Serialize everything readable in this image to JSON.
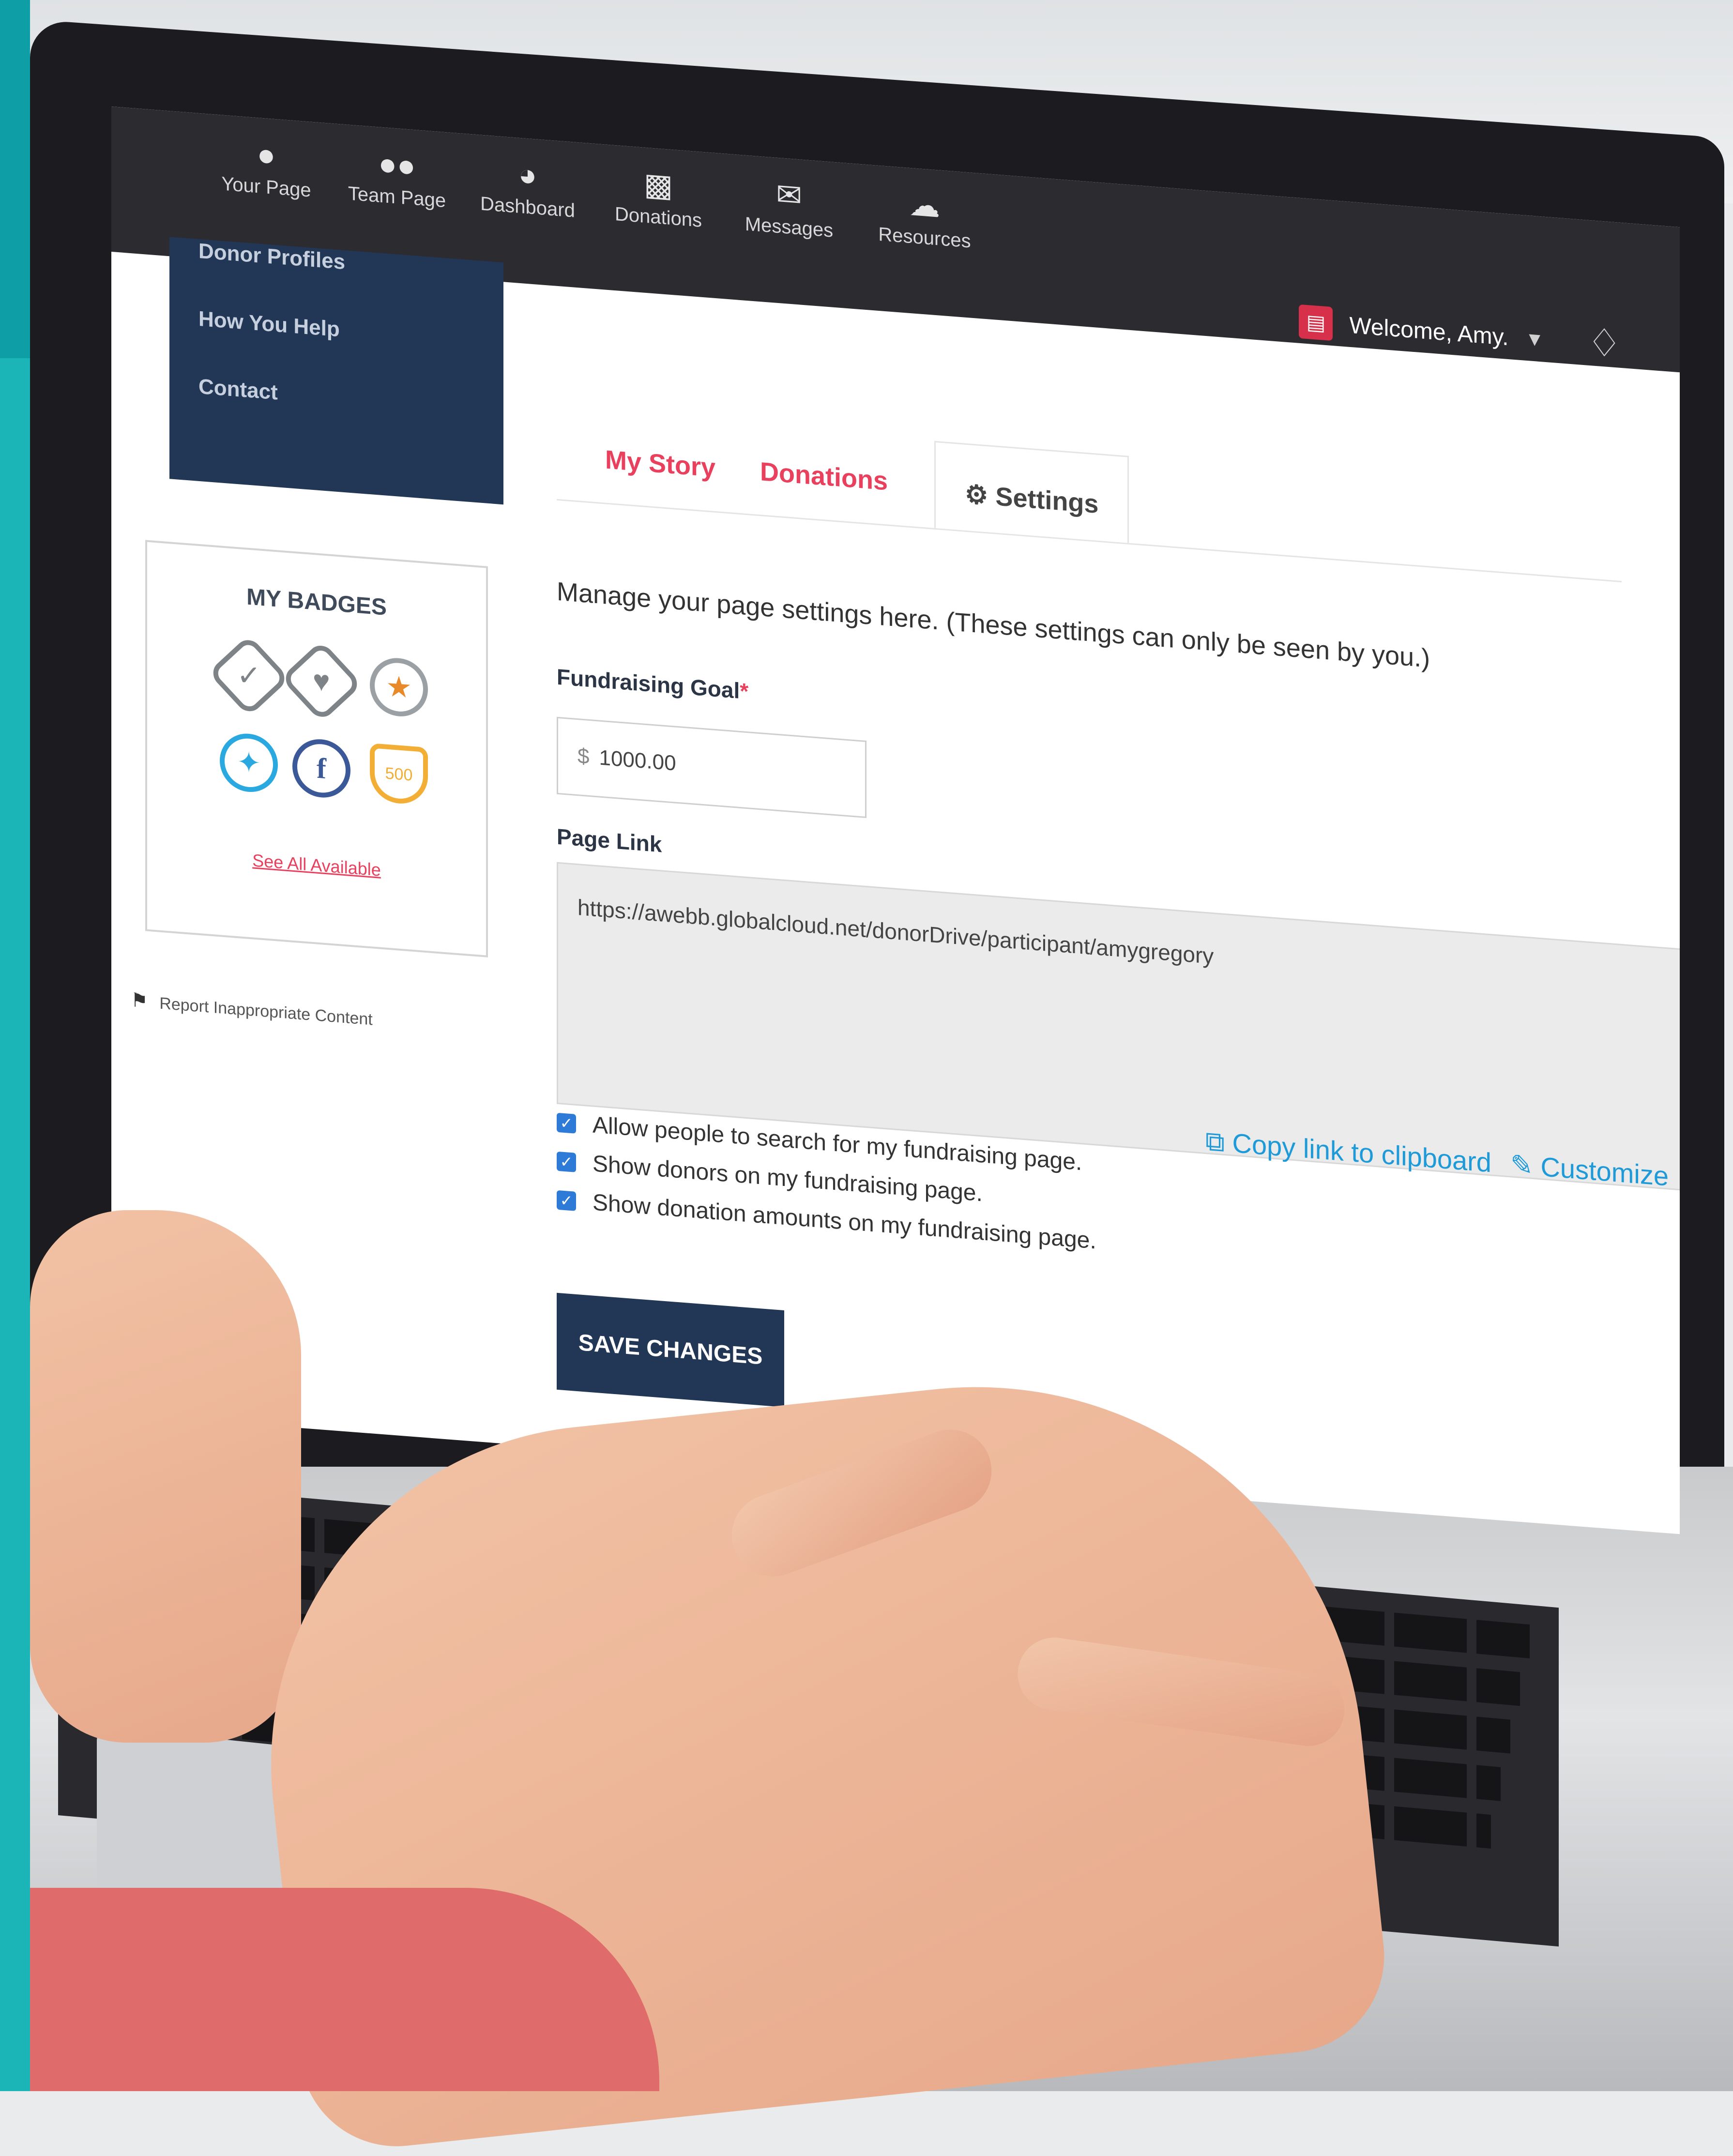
{
  "nav": {
    "items": [
      {
        "label": "Your Page",
        "icon": "user-icon"
      },
      {
        "label": "Team Page",
        "icon": "team-icon"
      },
      {
        "label": "Dashboard",
        "icon": "dashboard-icon"
      },
      {
        "label": "Donations",
        "icon": "gift-icon"
      },
      {
        "label": "Messages",
        "icon": "envelope-icon"
      },
      {
        "label": "Resources",
        "icon": "cloud-download-icon"
      }
    ],
    "welcome": "Welcome, Amy.",
    "avatar_icon": "cake-icon",
    "bell_icon": "bell-icon"
  },
  "sidebar": {
    "links": [
      "Donor Profiles",
      "How You Help",
      "Contact"
    ]
  },
  "badges": {
    "title": "MY BADGES",
    "shield_text": "500",
    "see_all": "See All Available"
  },
  "report": {
    "label": "Report Inappropriate Content"
  },
  "tabs": [
    {
      "label": "My Story"
    },
    {
      "label": "Donations"
    },
    {
      "label": "Settings",
      "icon": "gear-icon",
      "active": true
    }
  ],
  "settings": {
    "intro": "Manage your page settings here. (These settings can only be seen by you.)",
    "goal_label": "Fundraising Goal",
    "goal_required_mark": "*",
    "goal_currency": "$",
    "goal_value": "1000.00",
    "link_label": "Page Link",
    "link_value": "https://awebb.globalcloud.net/donorDrive/participant/amygregory",
    "copy_link": "Copy link to clipboard",
    "customize": "Customize",
    "checkboxes": [
      {
        "label": "Allow people to search for my fundraising page.",
        "checked": true
      },
      {
        "label": "Show donors on my fundraising page.",
        "checked": true
      },
      {
        "label": "Show donation amounts on my fundraising page.",
        "checked": true
      }
    ],
    "save": "SAVE CHANGES"
  },
  "colors": {
    "accent": "#e8405d",
    "navy": "#223656",
    "link_blue": "#1e9ad8",
    "teal": "#1bb5b8"
  }
}
